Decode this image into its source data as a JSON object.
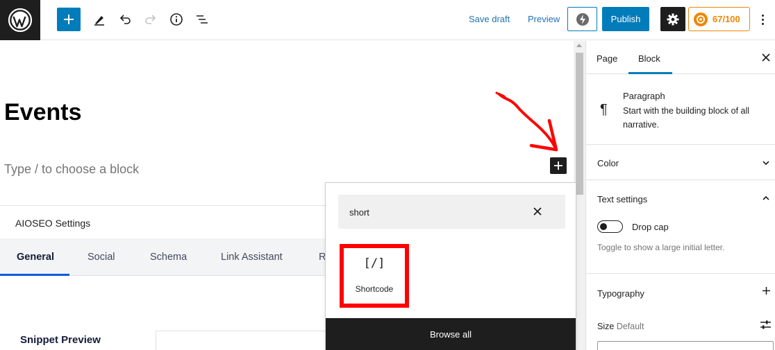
{
  "topbar": {
    "save_draft": "Save draft",
    "preview": "Preview",
    "publish": "Publish",
    "seo_score": "67/100",
    "icons": [
      "wordpress-logo-icon",
      "plus-icon",
      "pencil-icon",
      "undo-icon",
      "redo-icon",
      "info-icon",
      "list-view-icon",
      "jetpack-icon",
      "gear-icon",
      "aioseo-icon",
      "more-vertical-icon"
    ]
  },
  "editor": {
    "title": "Events",
    "placeholder": "Type / to choose a block"
  },
  "aioseo": {
    "title": "AIOSEO Settings",
    "tabs": [
      "General",
      "Social",
      "Schema",
      "Link Assistant",
      "R"
    ],
    "snippet_label": "Snippet Preview"
  },
  "inserter": {
    "search_value": "short",
    "result_icon": "[/]",
    "result_label": "Shortcode",
    "browse_all": "Browse all"
  },
  "sidebar": {
    "tab_page": "Page",
    "tab_block": "Block",
    "block_icon": "¶",
    "block_title": "Paragraph",
    "block_desc": "Start with the building block of all narrative.",
    "color": "Color",
    "text_settings": "Text settings",
    "drop_cap": "Drop cap",
    "drop_cap_help": "Toggle to show a large initial letter.",
    "typography": "Typography",
    "size": "Size",
    "size_default": "Default"
  },
  "colors": {
    "accent": "#007cba",
    "annotation": "#ff0000",
    "seo_orange": "#f18500",
    "dark": "#1e1e1e"
  }
}
